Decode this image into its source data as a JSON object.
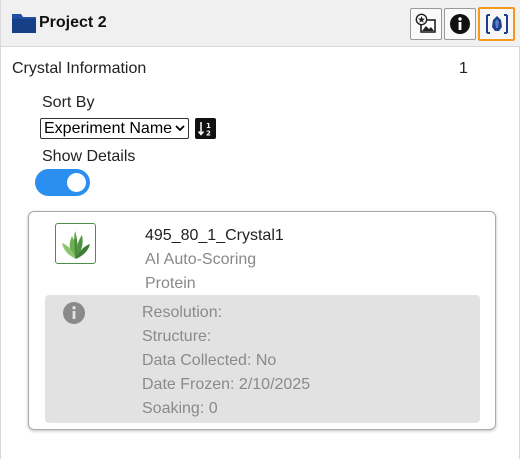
{
  "header": {
    "project_title": "Project 2",
    "icons": [
      "folder-icon",
      "image-star-icon",
      "info-icon",
      "crystal-icon"
    ],
    "accent_color": "#f39a1e"
  },
  "crystal_info": {
    "title": "Crystal Information",
    "count": "1"
  },
  "sort": {
    "label": "Sort By",
    "selected": "Experiment Name",
    "direction_icon": "sort-ascending-icon"
  },
  "show_details": {
    "label": "Show Details",
    "enabled": true,
    "toggle_color": "#2b8ff0"
  },
  "crystal": {
    "name": "495_80_1_Crystal1",
    "scoring": "AI Auto-Scoring",
    "type": "Protein",
    "details": {
      "resolution": "Resolution:",
      "structure": "Structure:",
      "data_collected": "Data Collected: No",
      "date_frozen": "Date Frozen: 2/10/2025",
      "soaking": "Soaking: 0"
    }
  }
}
